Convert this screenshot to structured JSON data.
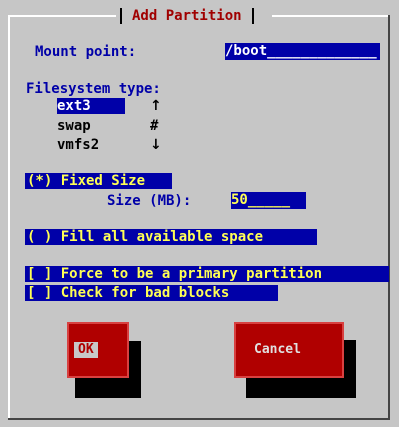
{
  "dialog": {
    "title": "Add Partition"
  },
  "mount_point": {
    "label": "Mount point:",
    "value": "/boot_____________"
  },
  "filesystem": {
    "label": "Filesystem type:",
    "items": [
      "ext3",
      "swap",
      "vmfs2"
    ],
    "selected": "ext3",
    "scroll_up": "↑",
    "scroll_thumb": "#",
    "scroll_down": "↓"
  },
  "fixed_size": {
    "label": "(*) Fixed Size",
    "size_label": "Size (MB):",
    "size_value": "50_____"
  },
  "fill_all": {
    "label": "( ) Fill all available space"
  },
  "force_primary": {
    "label": "[ ] Force to be a primary partition"
  },
  "bad_blocks": {
    "label": "[ ] Check for bad blocks"
  },
  "buttons": {
    "ok_label": "OK",
    "cancel_label": "Cancel"
  },
  "colors": {
    "background": "#c6c6c6",
    "highlight": "#0000a8",
    "highlight_text": "#ffff55",
    "title": "#a00000",
    "button": "#b00000"
  }
}
